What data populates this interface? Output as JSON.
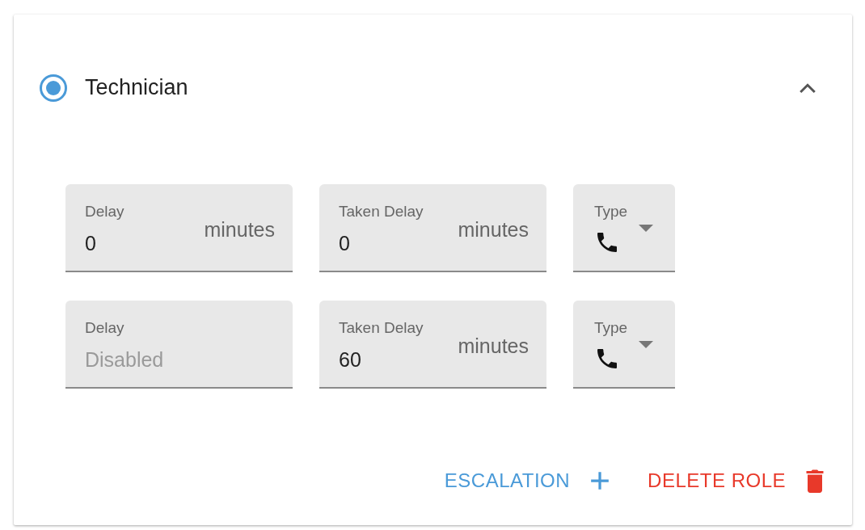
{
  "role": {
    "label": "Technician",
    "selected": true,
    "expanded": true
  },
  "escalations": [
    {
      "delay": {
        "label": "Delay",
        "value": "0",
        "suffix": "minutes",
        "disabled": false
      },
      "taken_delay": {
        "label": "Taken Delay",
        "value": "0",
        "suffix": "minutes",
        "disabled": false
      },
      "type": {
        "label": "Type"
      }
    },
    {
      "delay": {
        "label": "Delay",
        "placeholder": "Disabled",
        "disabled": true
      },
      "taken_delay": {
        "label": "Taken Delay",
        "value": "60",
        "suffix": "minutes",
        "disabled": false
      },
      "type": {
        "label": "Type"
      }
    }
  ],
  "actions": [
    {
      "label": "ESCALATION",
      "kind": "add"
    },
    {
      "label": "DELETE ROLE",
      "kind": "delete"
    }
  ]
}
